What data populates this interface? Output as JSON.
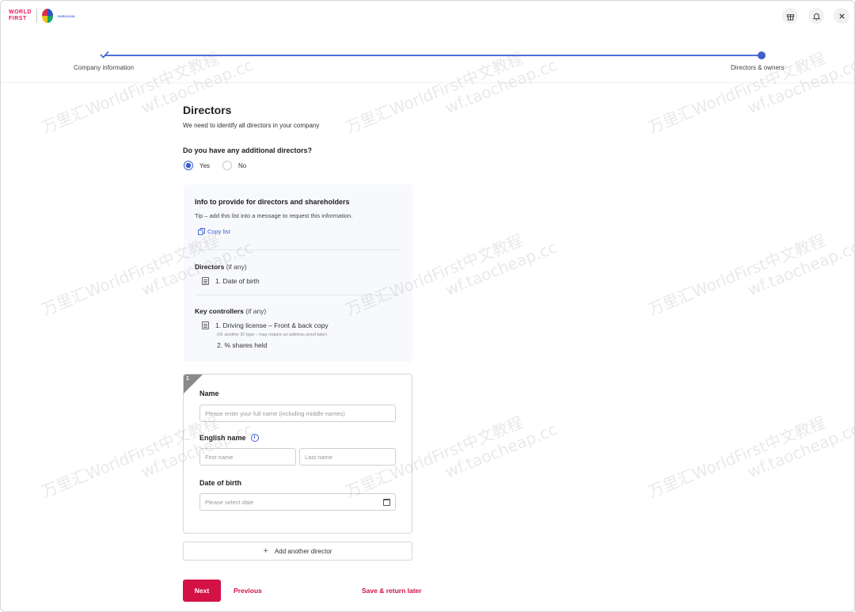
{
  "header": {
    "logo_line1": "WORLD",
    "logo_line2": "FIRST",
    "logo_sub": "EUROCOIN",
    "buttons": [
      {
        "icon": "gift-icon"
      },
      {
        "icon": "bell-icon"
      },
      {
        "icon": "close-icon"
      }
    ]
  },
  "stepper": {
    "steps": [
      {
        "label": "Company information",
        "state": "done"
      },
      {
        "label": "Directors & owners",
        "state": "current"
      }
    ],
    "accent": "#3d5fcc"
  },
  "form": {
    "title": "Directors",
    "subtitle": "We need to identify all directors in your company",
    "question": "Do you have any additional directors?",
    "options": [
      {
        "label": "Yes",
        "selected": true
      },
      {
        "label": "No",
        "selected": false
      }
    ]
  },
  "info": {
    "title": "Info to provide for directors and shareholders",
    "tip": "Tip – add this list into a message to request this information.",
    "copy_label": "Copy list",
    "directors_heading": "Directors",
    "directors_qualifier": "(if any)",
    "directors_items": [
      "1. Date of birth"
    ],
    "controllers_heading": "Key controllers",
    "controllers_qualifier": "(if any)",
    "controllers_items": [
      "1. Driving license – Front & back copy",
      "2. % shares held"
    ],
    "controllers_note": "(Or another ID type – may require an address proof later)"
  },
  "director_card": {
    "number": "1",
    "name_label": "Name",
    "name_placeholder": "Please enter your full name (including middle names)",
    "english_label": "English name",
    "first_placeholder": "First name",
    "last_placeholder": "Last name",
    "dob_label": "Date of birth",
    "dob_placeholder": "Please select date"
  },
  "actions": {
    "add_director": "Add another director",
    "next": "Next",
    "previous": "Previous",
    "save_return": "Save & return later",
    "brand_color": "#d31145"
  },
  "watermark": {
    "line1": "万里汇WorldFirst中文教程",
    "line2": "wf.taocheap.cc"
  }
}
